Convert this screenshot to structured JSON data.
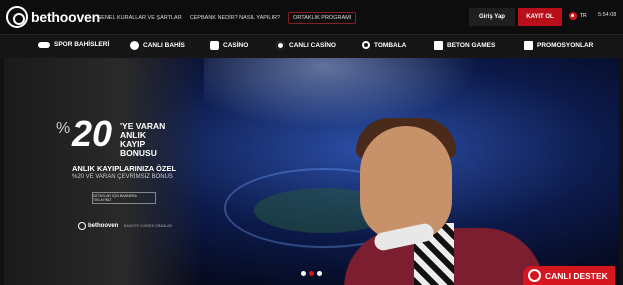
{
  "brand": {
    "name": "bethooven"
  },
  "toplinks": [
    "GENEL KURALLAR VE ŞARTLAR",
    "CEPBANK NEDİR? NASIL YAPILIR?",
    "ORTAKLIK PROGRAMI"
  ],
  "auth": {
    "login_label": "Giriş Yap",
    "register_label": "KAYIT OL"
  },
  "lang": {
    "code": "TR"
  },
  "clock": {
    "time": "5:54:08"
  },
  "nav": [
    {
      "label": "SPOR BAHİSLERİ",
      "icon": "sports-icon"
    },
    {
      "label": "CANLI BAHİS",
      "icon": "stopwatch-icon"
    },
    {
      "label": "CASİNO",
      "icon": "dice-icon"
    },
    {
      "label": "CANLI CASİNO",
      "icon": "chip-icon"
    },
    {
      "label": "TOMBALA",
      "icon": "bingo-ball-icon"
    },
    {
      "label": "BETON GAMES",
      "icon": "cards-icon"
    },
    {
      "label": "PROMOSYONLAR",
      "icon": "gift-icon"
    }
  ],
  "hero": {
    "percent_sign": "%",
    "big_number": "20",
    "line1": "'YE VARAN",
    "line2": "ANLIK",
    "line3": "KAYIP",
    "line3b": "BONUSU",
    "line4": "ANLIK KAYIPLARINIZA ÖZEL",
    "line5": "%20 VE VARAN ÇEVRİMSİZ BONUS",
    "detail_button": "DETAYLAR İÇİN BANNERA TIKLAYINIZ",
    "logo_text": "bethooven",
    "small_text": "BAHİSTE YÜKSEK ORANLAR",
    "slides": 3,
    "active_slide": 2
  },
  "support": {
    "label": "CANLI DESTEK"
  },
  "colors": {
    "accent": "#d5161f",
    "topbar": "#0d0d0d",
    "nav": "#161616"
  }
}
